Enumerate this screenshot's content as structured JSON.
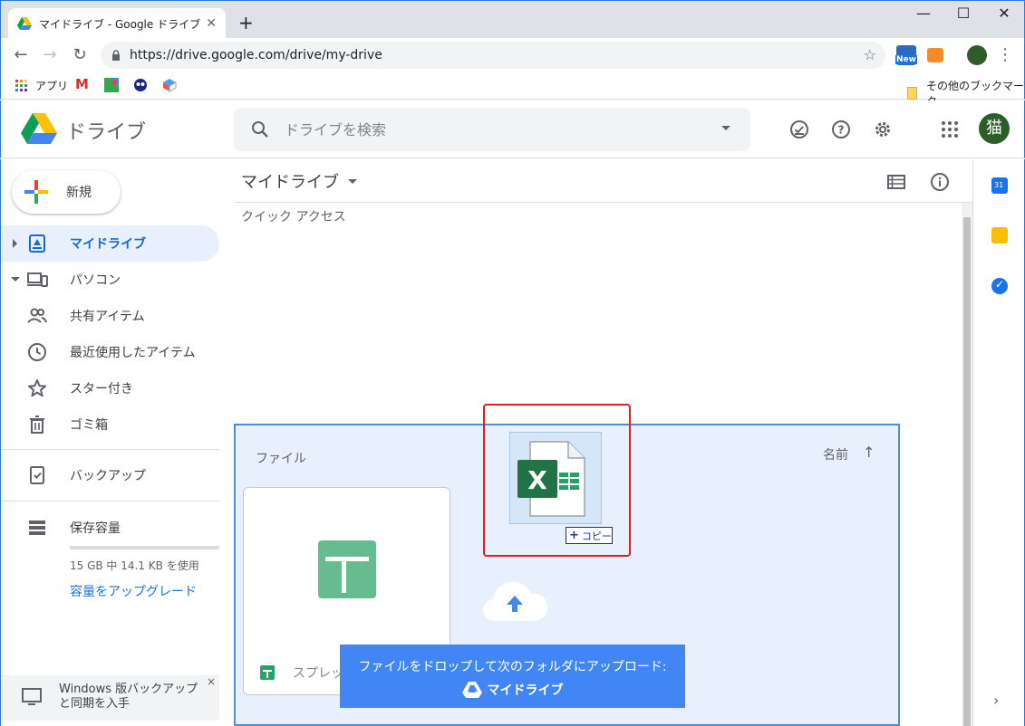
{
  "browser": {
    "tab_title": "マイドライブ - Google ドライブ",
    "url": "https://drive.google.com/drive/my-drive",
    "new_badge": "New",
    "bookmarks": {
      "apps": "アプリ",
      "other": "その他のブックマーク"
    }
  },
  "header": {
    "logo_text": "ドライブ",
    "search_placeholder": "ドライブを検索",
    "avatar_text": "猫"
  },
  "sidebar": {
    "new_label": "新規",
    "items": [
      {
        "label": "マイドライブ",
        "icon": "my-drive-icon",
        "active": true
      },
      {
        "label": "パソコン",
        "icon": "computers-icon"
      },
      {
        "label": "共有アイテム",
        "icon": "shared-icon"
      },
      {
        "label": "最近使用したアイテム",
        "icon": "recent-icon"
      },
      {
        "label": "スター付き",
        "icon": "star-icon"
      },
      {
        "label": "ゴミ箱",
        "icon": "trash-icon"
      },
      {
        "label": "バックアップ",
        "icon": "backup-icon"
      },
      {
        "label": "保存容量",
        "icon": "storage-icon"
      }
    ],
    "storage_text": "15 GB 中 14.1 KB を使用",
    "storage_fraction": 0.0001,
    "upgrade_link": "容量をアップグレード",
    "promo_text": "Windows 版バックアップと同期を入手",
    "promo_close": "×"
  },
  "main": {
    "title": "マイドライブ",
    "quick_access": "クイック アクセス",
    "files_label": "ファイル",
    "sort_label": "名前",
    "sort_arrow": "↑",
    "file_card_name": "スプレッ",
    "drop_text": "ファイルをドロップして次のフォルダにアップロード:",
    "drop_folder": "マイドライブ",
    "copy_label": "コピー",
    "right_chevron": "›"
  },
  "colors": {
    "accent": "#1a73e8",
    "active_bg": "#e8f0fe",
    "drop_banner": "#4285f4",
    "excel_green": "#217346",
    "highlight_red": "#e02020"
  }
}
